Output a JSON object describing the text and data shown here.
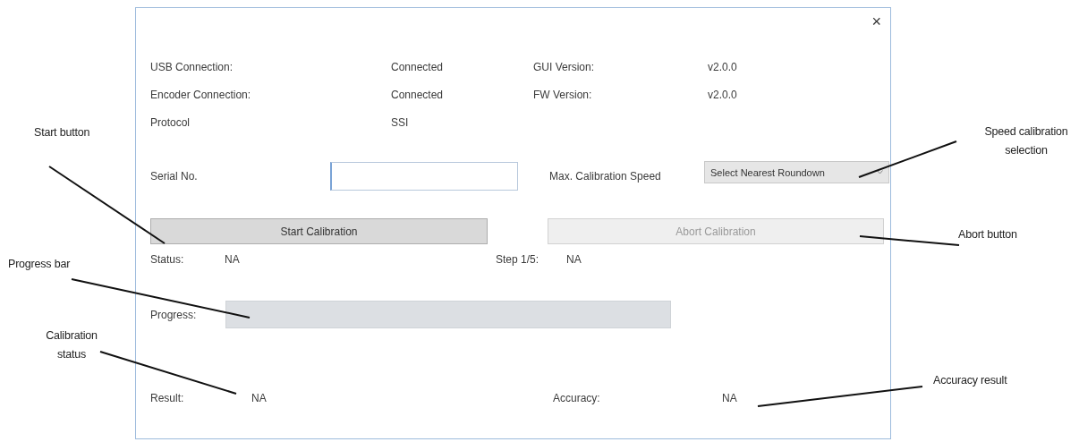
{
  "window": {
    "close": "×"
  },
  "info": [
    {
      "label": "USB Connection:",
      "value": "Connected",
      "label_2": "GUI Version:",
      "value_2": "v2.0.0"
    },
    {
      "label": "Encoder Connection:",
      "value": "Connected",
      "label_2": "FW Version:",
      "value_2": "v2.0.0"
    },
    {
      "label": "Protocol",
      "value": "SSI"
    }
  ],
  "serial": {
    "label": "Serial No."
  },
  "speed": {
    "label": "Max. Calibration Speed",
    "value": "Select Nearest Roundown"
  },
  "buttons": [
    {
      "label": "Start Calibration",
      "disabled": false
    },
    {
      "label": "Abort Calibration",
      "disabled": true
    }
  ],
  "status": {
    "label": "Status:",
    "value": "NA",
    "step_label": "Step 1/5:",
    "step_value": "NA"
  },
  "progress": {
    "label": "Progress:",
    "level": 0
  },
  "result": {
    "label": "Result:",
    "value": "NA",
    "accuracy_label": "Accuracy:",
    "accuracy_value": "NA"
  },
  "callouts": [
    {
      "text": "Start button"
    },
    {
      "text": "Progress bar"
    },
    {
      "text": "Calibration status"
    },
    {
      "text": "Speed calibration selection"
    },
    {
      "text": "Abort button"
    },
    {
      "text": "Accuracy result"
    }
  ]
}
